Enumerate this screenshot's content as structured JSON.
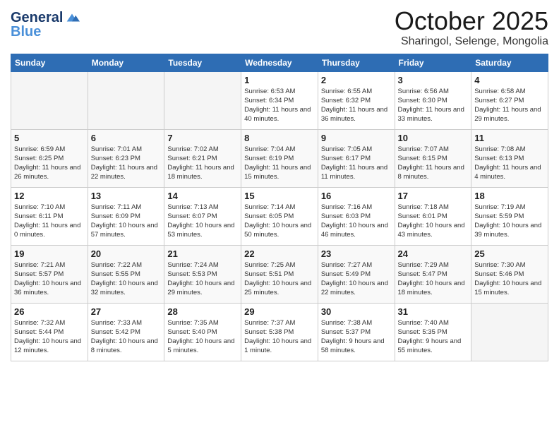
{
  "header": {
    "logo_line1": "General",
    "logo_line2": "Blue",
    "month": "October 2025",
    "location": "Sharingol, Selenge, Mongolia"
  },
  "weekdays": [
    "Sunday",
    "Monday",
    "Tuesday",
    "Wednesday",
    "Thursday",
    "Friday",
    "Saturday"
  ],
  "weeks": [
    [
      {
        "day": "",
        "sunrise": "",
        "sunset": "",
        "daylight": "",
        "empty": true
      },
      {
        "day": "",
        "sunrise": "",
        "sunset": "",
        "daylight": "",
        "empty": true
      },
      {
        "day": "",
        "sunrise": "",
        "sunset": "",
        "daylight": "",
        "empty": true
      },
      {
        "day": "1",
        "sunrise": "Sunrise: 6:53 AM",
        "sunset": "Sunset: 6:34 PM",
        "daylight": "Daylight: 11 hours and 40 minutes."
      },
      {
        "day": "2",
        "sunrise": "Sunrise: 6:55 AM",
        "sunset": "Sunset: 6:32 PM",
        "daylight": "Daylight: 11 hours and 36 minutes."
      },
      {
        "day": "3",
        "sunrise": "Sunrise: 6:56 AM",
        "sunset": "Sunset: 6:30 PM",
        "daylight": "Daylight: 11 hours and 33 minutes."
      },
      {
        "day": "4",
        "sunrise": "Sunrise: 6:58 AM",
        "sunset": "Sunset: 6:27 PM",
        "daylight": "Daylight: 11 hours and 29 minutes."
      }
    ],
    [
      {
        "day": "5",
        "sunrise": "Sunrise: 6:59 AM",
        "sunset": "Sunset: 6:25 PM",
        "daylight": "Daylight: 11 hours and 26 minutes."
      },
      {
        "day": "6",
        "sunrise": "Sunrise: 7:01 AM",
        "sunset": "Sunset: 6:23 PM",
        "daylight": "Daylight: 11 hours and 22 minutes."
      },
      {
        "day": "7",
        "sunrise": "Sunrise: 7:02 AM",
        "sunset": "Sunset: 6:21 PM",
        "daylight": "Daylight: 11 hours and 18 minutes."
      },
      {
        "day": "8",
        "sunrise": "Sunrise: 7:04 AM",
        "sunset": "Sunset: 6:19 PM",
        "daylight": "Daylight: 11 hours and 15 minutes."
      },
      {
        "day": "9",
        "sunrise": "Sunrise: 7:05 AM",
        "sunset": "Sunset: 6:17 PM",
        "daylight": "Daylight: 11 hours and 11 minutes."
      },
      {
        "day": "10",
        "sunrise": "Sunrise: 7:07 AM",
        "sunset": "Sunset: 6:15 PM",
        "daylight": "Daylight: 11 hours and 8 minutes."
      },
      {
        "day": "11",
        "sunrise": "Sunrise: 7:08 AM",
        "sunset": "Sunset: 6:13 PM",
        "daylight": "Daylight: 11 hours and 4 minutes."
      }
    ],
    [
      {
        "day": "12",
        "sunrise": "Sunrise: 7:10 AM",
        "sunset": "Sunset: 6:11 PM",
        "daylight": "Daylight: 11 hours and 0 minutes."
      },
      {
        "day": "13",
        "sunrise": "Sunrise: 7:11 AM",
        "sunset": "Sunset: 6:09 PM",
        "daylight": "Daylight: 10 hours and 57 minutes."
      },
      {
        "day": "14",
        "sunrise": "Sunrise: 7:13 AM",
        "sunset": "Sunset: 6:07 PM",
        "daylight": "Daylight: 10 hours and 53 minutes."
      },
      {
        "day": "15",
        "sunrise": "Sunrise: 7:14 AM",
        "sunset": "Sunset: 6:05 PM",
        "daylight": "Daylight: 10 hours and 50 minutes."
      },
      {
        "day": "16",
        "sunrise": "Sunrise: 7:16 AM",
        "sunset": "Sunset: 6:03 PM",
        "daylight": "Daylight: 10 hours and 46 minutes."
      },
      {
        "day": "17",
        "sunrise": "Sunrise: 7:18 AM",
        "sunset": "Sunset: 6:01 PM",
        "daylight": "Daylight: 10 hours and 43 minutes."
      },
      {
        "day": "18",
        "sunrise": "Sunrise: 7:19 AM",
        "sunset": "Sunset: 5:59 PM",
        "daylight": "Daylight: 10 hours and 39 minutes."
      }
    ],
    [
      {
        "day": "19",
        "sunrise": "Sunrise: 7:21 AM",
        "sunset": "Sunset: 5:57 PM",
        "daylight": "Daylight: 10 hours and 36 minutes."
      },
      {
        "day": "20",
        "sunrise": "Sunrise: 7:22 AM",
        "sunset": "Sunset: 5:55 PM",
        "daylight": "Daylight: 10 hours and 32 minutes."
      },
      {
        "day": "21",
        "sunrise": "Sunrise: 7:24 AM",
        "sunset": "Sunset: 5:53 PM",
        "daylight": "Daylight: 10 hours and 29 minutes."
      },
      {
        "day": "22",
        "sunrise": "Sunrise: 7:25 AM",
        "sunset": "Sunset: 5:51 PM",
        "daylight": "Daylight: 10 hours and 25 minutes."
      },
      {
        "day": "23",
        "sunrise": "Sunrise: 7:27 AM",
        "sunset": "Sunset: 5:49 PM",
        "daylight": "Daylight: 10 hours and 22 minutes."
      },
      {
        "day": "24",
        "sunrise": "Sunrise: 7:29 AM",
        "sunset": "Sunset: 5:47 PM",
        "daylight": "Daylight: 10 hours and 18 minutes."
      },
      {
        "day": "25",
        "sunrise": "Sunrise: 7:30 AM",
        "sunset": "Sunset: 5:46 PM",
        "daylight": "Daylight: 10 hours and 15 minutes."
      }
    ],
    [
      {
        "day": "26",
        "sunrise": "Sunrise: 7:32 AM",
        "sunset": "Sunset: 5:44 PM",
        "daylight": "Daylight: 10 hours and 12 minutes."
      },
      {
        "day": "27",
        "sunrise": "Sunrise: 7:33 AM",
        "sunset": "Sunset: 5:42 PM",
        "daylight": "Daylight: 10 hours and 8 minutes."
      },
      {
        "day": "28",
        "sunrise": "Sunrise: 7:35 AM",
        "sunset": "Sunset: 5:40 PM",
        "daylight": "Daylight: 10 hours and 5 minutes."
      },
      {
        "day": "29",
        "sunrise": "Sunrise: 7:37 AM",
        "sunset": "Sunset: 5:38 PM",
        "daylight": "Daylight: 10 hours and 1 minute."
      },
      {
        "day": "30",
        "sunrise": "Sunrise: 7:38 AM",
        "sunset": "Sunset: 5:37 PM",
        "daylight": "Daylight: 9 hours and 58 minutes."
      },
      {
        "day": "31",
        "sunrise": "Sunrise: 7:40 AM",
        "sunset": "Sunset: 5:35 PM",
        "daylight": "Daylight: 9 hours and 55 minutes."
      },
      {
        "day": "",
        "sunrise": "",
        "sunset": "",
        "daylight": "",
        "empty": true
      }
    ]
  ]
}
